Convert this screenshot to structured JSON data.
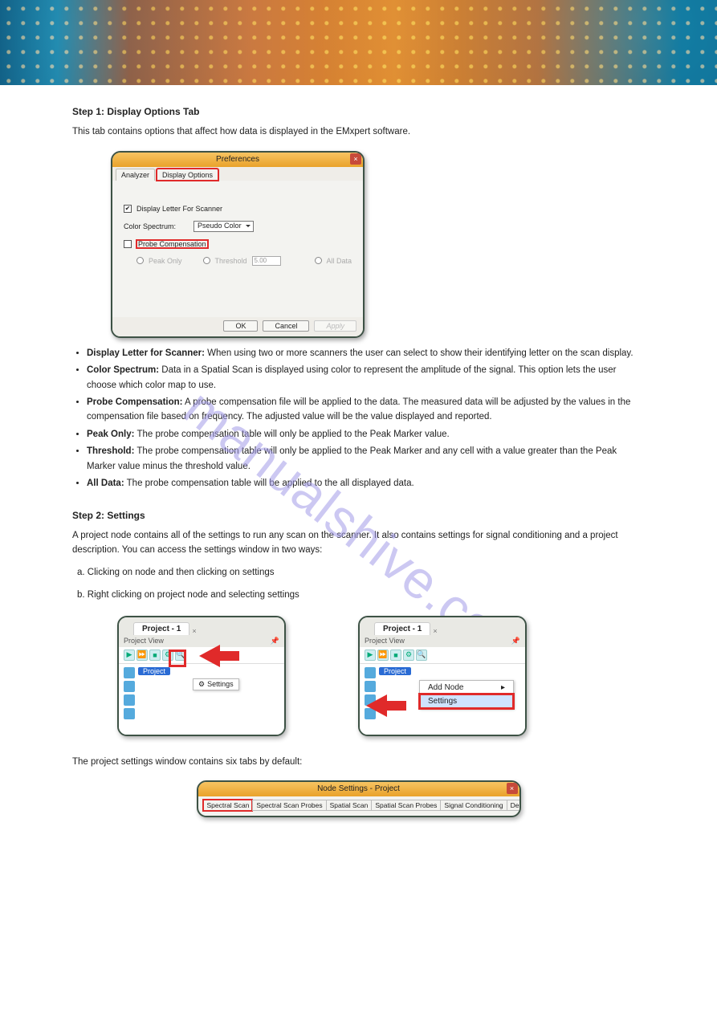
{
  "watermark": "manualshive.com",
  "step1": {
    "heading": "Step 1: Display Options Tab",
    "intro": "This tab contains options that affect how data is displayed in the EMxpert software."
  },
  "prefs": {
    "title": "Preferences",
    "tab_analyzer": "Analyzer",
    "tab_display": "Display Options",
    "cb_letter": "Display Letter For Scanner",
    "lbl_spectrum": "Color Spectrum:",
    "sel_spectrum": "Pseudo Color",
    "cb_probecomp": "Probe Compensation",
    "radio_peak": "Peak Only",
    "radio_thresh": "Threshold",
    "thresh_val": "5.00",
    "radio_all": "All Data",
    "btn_ok": "OK",
    "btn_cancel": "Cancel",
    "btn_apply": "Apply"
  },
  "bullets": [
    {
      "label": "Display Letter for Scanner:",
      "text": " When using two or more scanners the user can select to show their identifying letter on the scan display."
    },
    {
      "label": "Color Spectrum:",
      "text": " Data in a Spatial Scan is displayed using color to represent the amplitude of the signal. This option lets the user choose which color map to use."
    },
    {
      "label": "Probe Compensation:",
      "text": " A probe compensation file will be applied to the data. The measured data will be adjusted by the values in the compensation file based on frequency. The adjusted value will be the value displayed and reported."
    },
    {
      "label": "Peak Only:",
      "text": " The probe compensation table will only be applied to the Peak Marker value."
    },
    {
      "label": "Threshold:",
      "text": " The probe compensation table will only be applied to the Peak Marker and any cell with a value greater than the Peak Marker value minus the threshold value."
    },
    {
      "label": "All Data:",
      "text": " The probe compensation table will be applied to the all displayed data."
    }
  ],
  "settings_section": {
    "step2": "Step 2: Settings",
    "intro": "A project node contains all of the settings to run any scan on the scanner. It also contains settings for signal conditioning and a project description. You can access the settings window in two ways:",
    "optA": "a. Clicking on node and then clicking on settings",
    "optB": "b. Right clicking on project node and selecting settings"
  },
  "mini": {
    "project_tab": "Project - 1",
    "project_view": "Project View",
    "node_label": "Project",
    "tooltip": "Settings",
    "ctx_add": "Add Node",
    "ctx_settings": "Settings"
  },
  "tabsline": "The project settings window contains six tabs by default:",
  "nodeset": {
    "title": "Node Settings - Project",
    "tabs": [
      "Spectral Scan",
      "Spectral Scan Probes",
      "Spatial Scan",
      "Spatial Scan Probes",
      "Signal Conditioning",
      "Description"
    ]
  }
}
